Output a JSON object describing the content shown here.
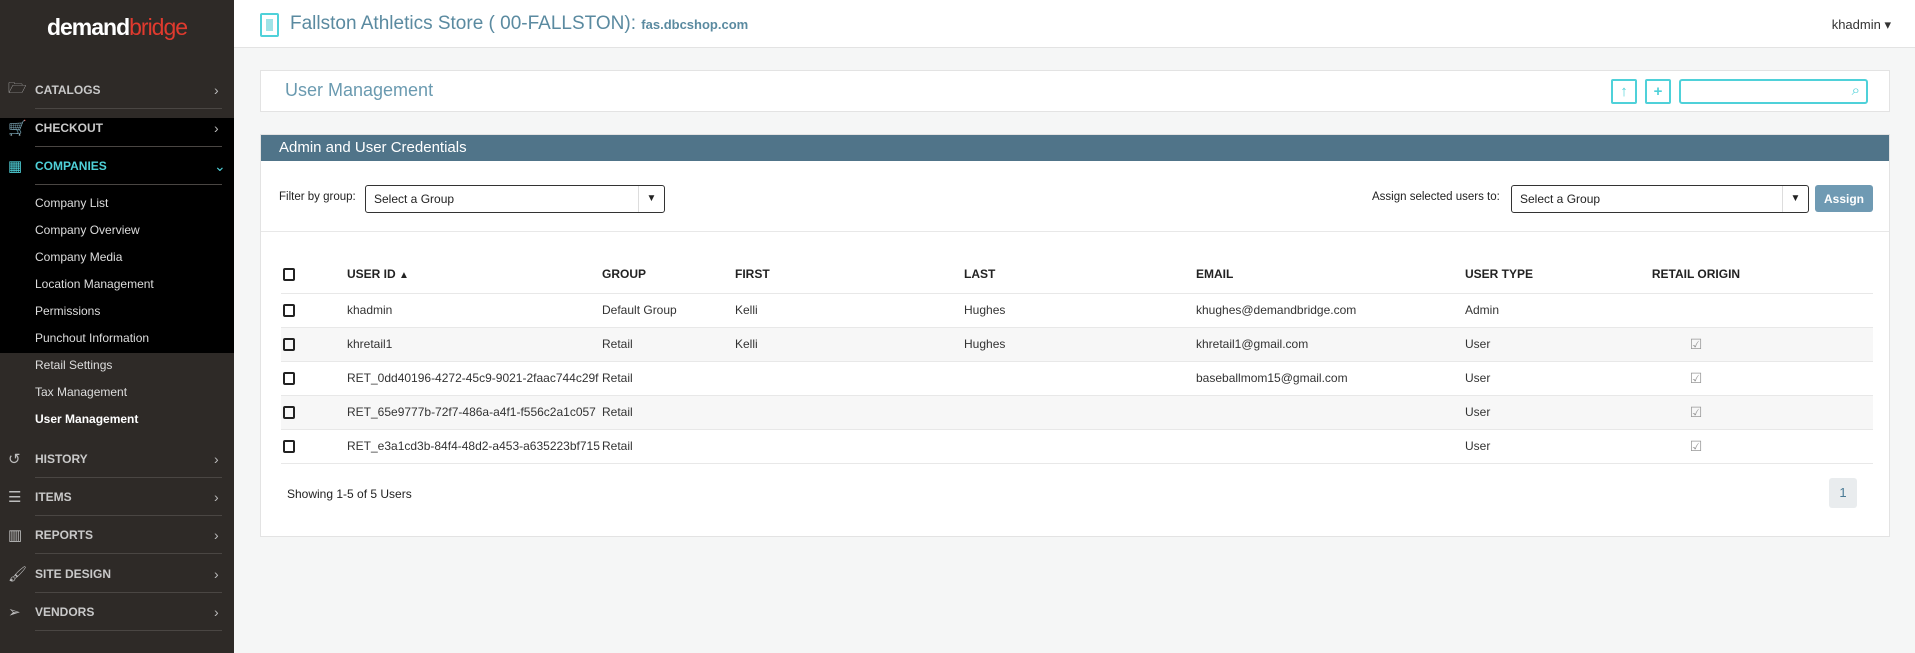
{
  "sidebar": {
    "logo": {
      "part1": "demand",
      "part2": "bridge"
    },
    "items": [
      {
        "label": "CATALOGS",
        "icon": "folder-open-icon"
      },
      {
        "label": "CHECKOUT",
        "icon": "cart-icon"
      },
      {
        "label": "COMPANIES",
        "icon": "building-icon"
      },
      {
        "label": "HISTORY",
        "icon": "history-icon"
      },
      {
        "label": "ITEMS",
        "icon": "list-icon"
      },
      {
        "label": "REPORTS",
        "icon": "bar-chart-icon"
      },
      {
        "label": "SITE DESIGN",
        "icon": "brush-icon"
      },
      {
        "label": "VENDORS",
        "icon": "paper-plane-icon"
      }
    ],
    "subitems": [
      "Company List",
      "Company Overview",
      "Company Media",
      "Location Management",
      "Permissions",
      "Punchout Information",
      "Retail Settings",
      "Tax Management",
      "User Management"
    ]
  },
  "header": {
    "store": "Fallston Athletics Store ( 00-FALLSTON):",
    "domain": "fas.dbcshop.com",
    "user": "khadmin"
  },
  "page": {
    "title": "User Management",
    "search_placeholder": ""
  },
  "section": {
    "title": "Admin and User Credentials",
    "filter_label": "Filter by group:",
    "filter_value": "Select a Group",
    "assign_label": "Assign selected users to:",
    "assign_value": "Select a Group",
    "assign_button": "Assign"
  },
  "table": {
    "headers": [
      "USER ID",
      "GROUP",
      "FIRST",
      "LAST",
      "EMAIL",
      "USER TYPE",
      "RETAIL ORIGIN"
    ],
    "rows": [
      {
        "id": "khadmin",
        "group": "Default Group",
        "first": "Kelli",
        "last": "Hughes",
        "email": "khughes@demandbridge.com",
        "type": "Admin",
        "retail": false
      },
      {
        "id": "khretail1",
        "group": "Retail",
        "first": "Kelli",
        "last": "Hughes",
        "email": "khretail1@gmail.com",
        "type": "User",
        "retail": true
      },
      {
        "id": "RET_0dd40196-4272-45c9-9021-2faac744c29f",
        "group": "Retail",
        "first": "",
        "last": "",
        "email": "baseballmom15@gmail.com",
        "type": "User",
        "retail": true
      },
      {
        "id": "RET_65e9777b-72f7-486a-a4f1-f556c2a1c057",
        "group": "Retail",
        "first": "",
        "last": "",
        "email": "",
        "type": "User",
        "retail": true
      },
      {
        "id": "RET_e3a1cd3b-84f4-48d2-a453-a635223bf715",
        "group": "Retail",
        "first": "",
        "last": "",
        "email": "",
        "type": "User",
        "retail": true
      }
    ]
  },
  "footer": {
    "showing": "Showing 1-5 of 5 Users",
    "page": "1"
  },
  "colors": {
    "accent": "#4fd1d9",
    "header_bar": "#507489",
    "sidebar": "#2e2a27"
  }
}
